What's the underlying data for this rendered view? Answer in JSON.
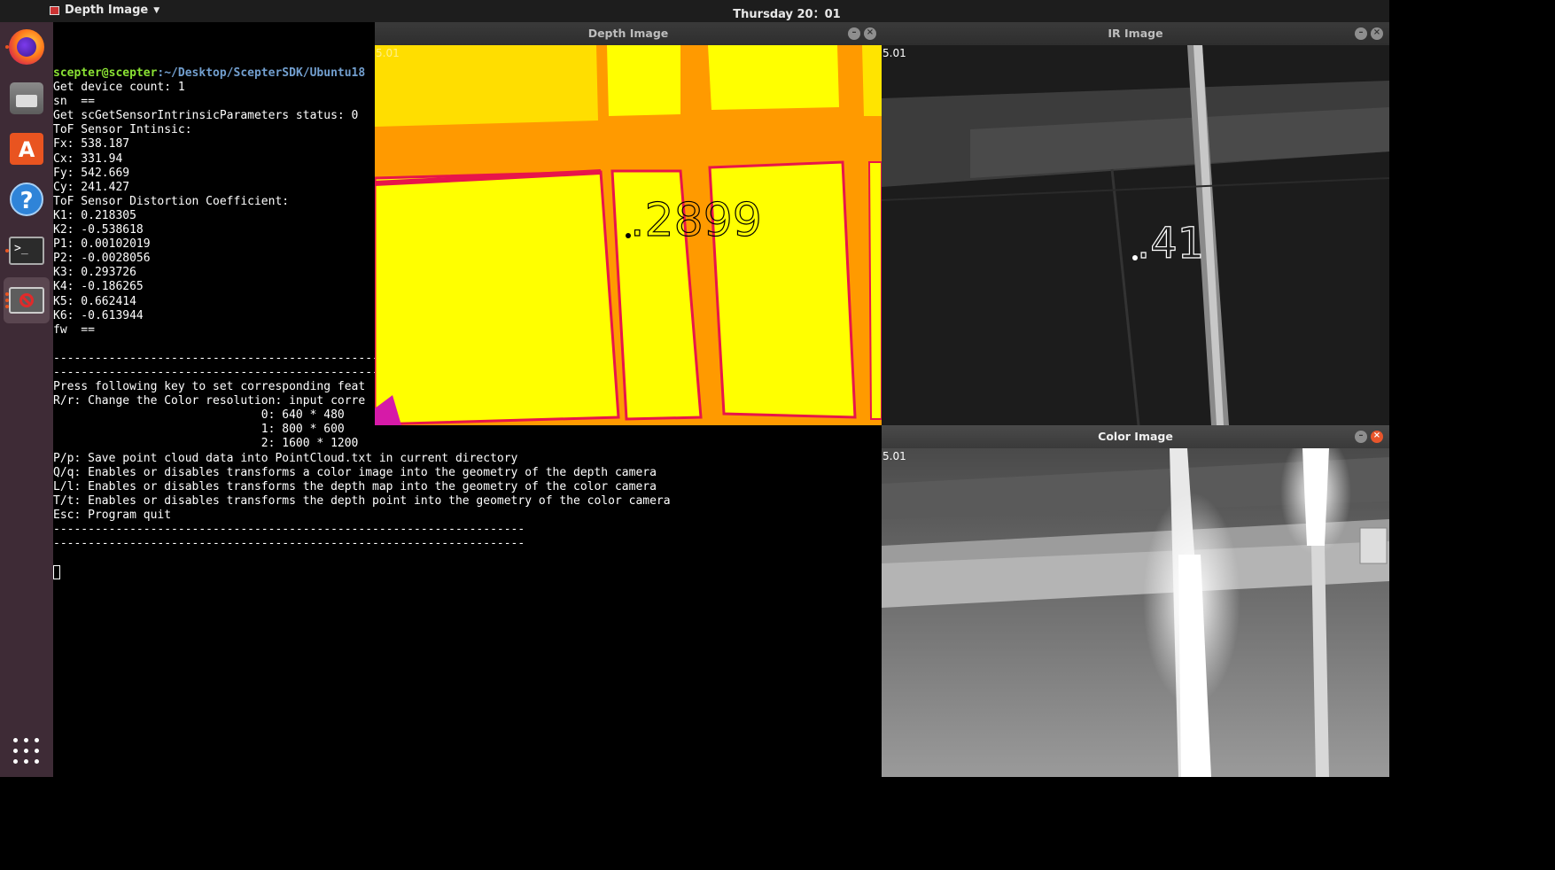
{
  "topbar": {
    "app_name": "Depth Image",
    "clock": "Thursday 20：01"
  },
  "dock": {
    "items": [
      {
        "name": "firefox",
        "icon": "firefox-icon"
      },
      {
        "name": "files",
        "icon": "files-icon"
      },
      {
        "name": "software",
        "icon": "software-store-icon",
        "glyph": "A"
      },
      {
        "name": "help",
        "icon": "help-icon",
        "glyph": "?"
      },
      {
        "name": "terminal",
        "icon": "terminal-icon",
        "glyph": ">_"
      },
      {
        "name": "sample-app",
        "icon": "blocked-app-icon"
      }
    ]
  },
  "terminal": {
    "prompt_user": "scepter@scepter",
    "prompt_path": ":~/Desktop/ScepterSDK/Ubuntu18",
    "lines": [
      "Get device count: 1",
      "sn  ==",
      "Get scGetSensorIntrinsicParameters status: 0",
      "ToF Sensor Intinsic:",
      "Fx: 538.187",
      "Cx: 331.94",
      "Fy: 542.669",
      "Cy: 241.427",
      "ToF Sensor Distortion Coefficient:",
      "K1: 0.218305",
      "K2: -0.538618",
      "P1: 0.00102019",
      "P2: -0.0028056",
      "K3: 0.293726",
      "K4: -0.186265",
      "K5: 0.662414",
      "K6: -0.613944",
      "fw  ==",
      "",
      "--------------------------------------------------------------------",
      "--------------------------------------------------------------------",
      "Press following key to set corresponding feat",
      "R/r: Change the Color resolution: input corre",
      "                              0: 640 * 480",
      "                              1: 800 * 600",
      "                              2: 1600 * 1200",
      "P/p: Save point cloud data into PointCloud.txt in current directory",
      "Q/q: Enables or disables transforms a color image into the geometry of the depth camera",
      "L/l: Enables or disables transforms the depth map into the geometry of the color camera",
      "T/t: Enables or disables transforms the depth point into the geometry of the color camera",
      "Esc: Program quit",
      "--------------------------------------------------------------------",
      "--------------------------------------------------------------------",
      ""
    ]
  },
  "windows": {
    "depth": {
      "title": "Depth Image",
      "fps": "5.01",
      "measure": ".2899"
    },
    "ir": {
      "title": "IR Image",
      "fps": "5.01",
      "measure": ".41"
    },
    "color": {
      "title": "Color Image",
      "fps": "5.01"
    }
  },
  "colors": {
    "depth_far": "#ffff00",
    "depth_mid": "#ff9a00",
    "depth_edge": "#e8154a",
    "ubuntu_orange": "#e95420",
    "dock_bg": "#3e2b36"
  }
}
